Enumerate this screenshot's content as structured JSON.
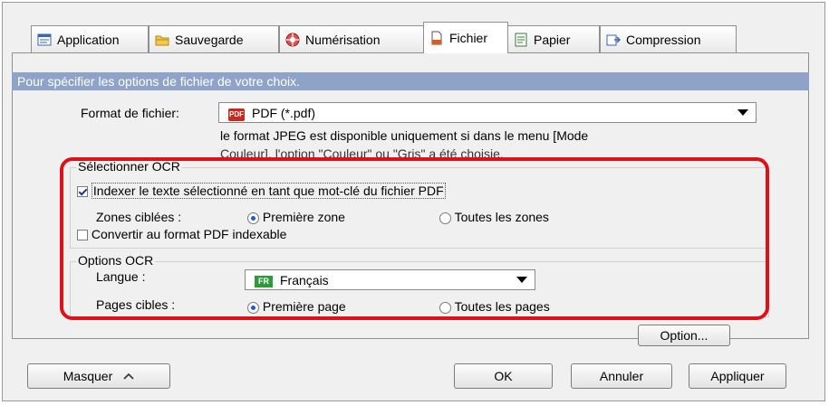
{
  "tabs": [
    {
      "label": "Application",
      "icon": "application-icon"
    },
    {
      "label": "Sauvegarde",
      "icon": "folder-icon"
    },
    {
      "label": "Numérisation",
      "icon": "scan-icon"
    },
    {
      "label": "Fichier",
      "icon": "file-icon"
    },
    {
      "label": "Papier",
      "icon": "paper-icon"
    },
    {
      "label": "Compression",
      "icon": "compression-icon"
    }
  ],
  "active_tab": "Fichier",
  "banner": "Pour spécifier les options de fichier de votre choix.",
  "file_format": {
    "label": "Format de fichier:",
    "badge": "PDF",
    "value": "PDF (*.pdf)",
    "note_line1": "le format JPEG est disponible uniquement si dans le menu [Mode",
    "note_line2": "Couleur], l'option \"Couleur\" ou \"Gris\" a été choisie."
  },
  "ocr_select": {
    "title": "Sélectionner OCR",
    "index_text": "Indexer le texte sélectionné en tant que mot-clé du fichier PDF",
    "index_checked": true,
    "zones_label": "Zones ciblées :",
    "zone_first": "Première zone",
    "zone_all": "Toutes les zones",
    "convert_text": "Convertir  au format PDF indexable",
    "convert_checked": false
  },
  "ocr_options": {
    "title": "Options OCR",
    "language_label": "Langue :",
    "language_badge": "FR",
    "language_value": "Français",
    "pages_label": "Pages cibles :",
    "page_first": "Première page",
    "page_all": "Toutes les pages"
  },
  "buttons": {
    "option": "Option...",
    "hide": "Masquer",
    "ok": "OK",
    "cancel": "Annuler",
    "apply": "Appliquer"
  },
  "colors": {
    "banner": "#8fa3c8",
    "highlight": "#e0101a"
  }
}
